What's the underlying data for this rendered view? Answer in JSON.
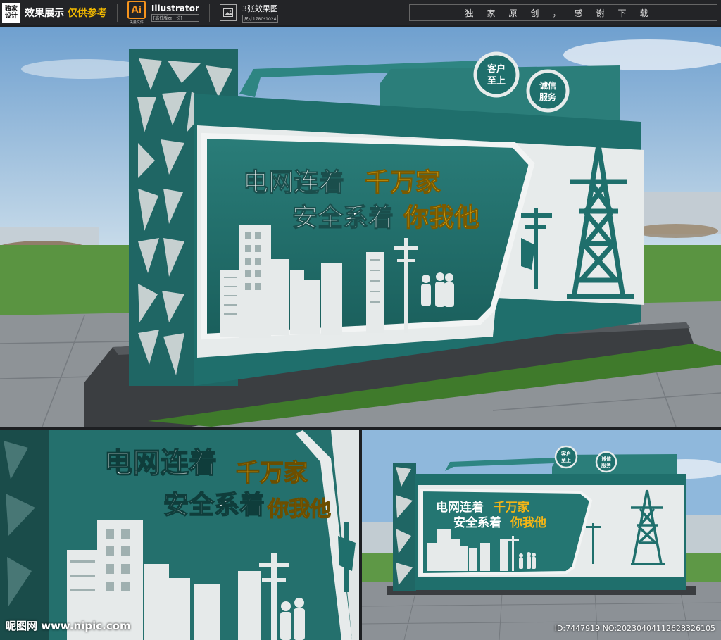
{
  "header": {
    "brand_box": "独家设计",
    "brand_prefix": "效果展示",
    "brand_highlight": "仅供参考",
    "ai_icon_label": "Ai",
    "ai_sub": "矢量文件",
    "software_title": "Illustrator",
    "software_tag": "[高低版本一份]",
    "images_title": "3张效果图",
    "images_tag": "尺寸1780*1024",
    "thanks": "独家原创，感谢下载"
  },
  "sign": {
    "slogan_line1_white": "电网连着",
    "slogan_line1_yellow": "千万家",
    "slogan_line2_white": "安全系着",
    "slogan_line2_yellow": "你我他",
    "badge1_line1": "客户",
    "badge1_line2": "至上",
    "badge2_line1": "诚信",
    "badge2_line2": "服务"
  },
  "footer": {
    "watermark": "昵图网 www.nipic.com",
    "id_text": "ID:7447919 NO:20230404112628326105"
  },
  "colors": {
    "teal": "#1f6e6b",
    "teal_dark": "#134846",
    "panel_white": "#e8ecec",
    "yellow": "#f3b515",
    "sky": "#9dc3e2",
    "grass": "#4e8a37"
  }
}
